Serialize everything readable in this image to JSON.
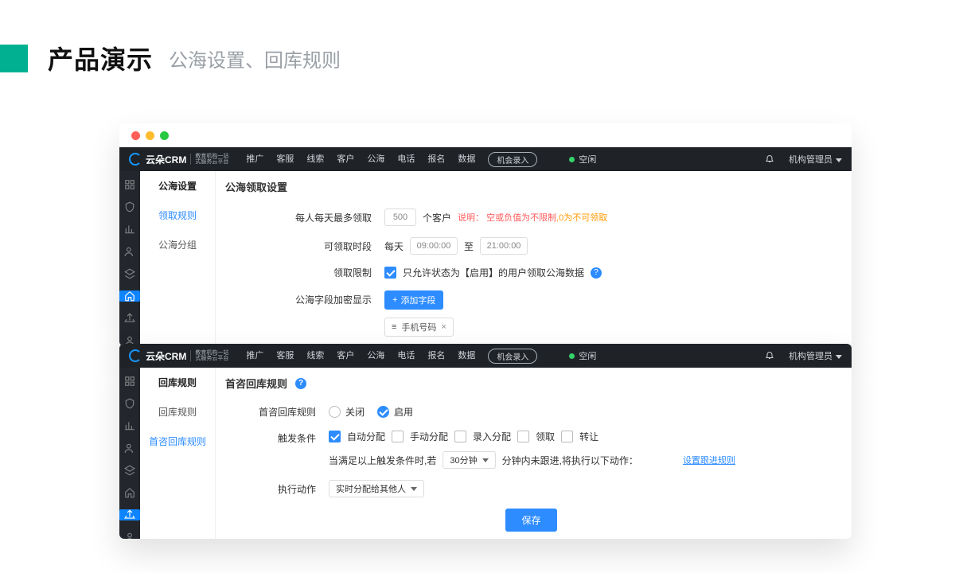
{
  "slide": {
    "title": "产品演示",
    "subtitle": "公海设置、回库规则"
  },
  "logo": {
    "brand": "云朵CRM",
    "sub1": "教育机构一站",
    "sub2": "式服务云平台"
  },
  "nav": {
    "items": [
      "推广",
      "客服",
      "线索",
      "客户",
      "公海",
      "电话",
      "报名",
      "数据"
    ],
    "button": "机会录入",
    "status": "空闲",
    "user": "机构管理员"
  },
  "panel1": {
    "side_header": "公海设置",
    "side_items": [
      "领取规则",
      "公海分组"
    ],
    "title": "公海领取设置",
    "rows": {
      "perday_label": "每人每天最多领取",
      "perday_value": "500",
      "perday_unit": "个客户",
      "hint_prefix": "说明：",
      "hint_red": "空或负值为不限制",
      "hint_sep": ",",
      "hint_orange": "0为不可领取",
      "time_label": "可领取时段",
      "time_daily": "每天",
      "time_from": "09:00:00",
      "time_to_word": "至",
      "time_to": "21:00:00",
      "limit_label": "领取限制",
      "limit_text": "只允许状态为【启用】的用户领取公海数据",
      "enc_label": "公海字段加密显示",
      "enc_add": "添加字段",
      "chip_text": "手机号码",
      "chip_prefix": "≡"
    }
  },
  "panel2": {
    "side_header": "回库规则",
    "side_items": [
      "回库规则",
      "首咨回库规则"
    ],
    "title": "首咨回库规则",
    "rows": {
      "rule_label": "首咨回库规则",
      "off": "关闭",
      "on": "启用",
      "trig_label": "触发条件",
      "cb_auto": "自动分配",
      "cb_manual": "手动分配",
      "cb_import": "录入分配",
      "cb_claim": "领取",
      "cb_trans": "转让",
      "trig_line_a": "当满足以上触发条件时,若",
      "trig_sel": "30分钟",
      "trig_line_b": "分钟内未跟进,将执行以下动作：",
      "trig_link": "设置跟进规则",
      "act_label": "执行动作",
      "act_sel": "实时分配给其他人",
      "save": "保存"
    }
  }
}
